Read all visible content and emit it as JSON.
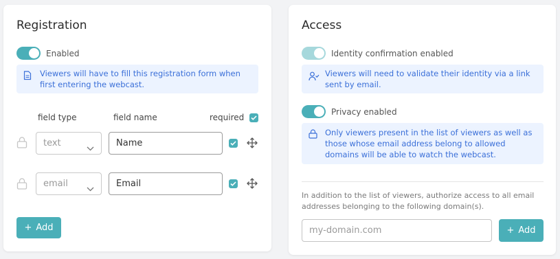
{
  "registration": {
    "title": "Registration",
    "enabled_label": "Enabled",
    "info_text": "Viewers will have to fill this registration form when first entering the webcast.",
    "headers": {
      "field_type": "field type",
      "field_name": "field name",
      "required": "required"
    },
    "fields": [
      {
        "type": "text",
        "name": "Name",
        "required": true
      },
      {
        "type": "email",
        "name": "Email",
        "required": true
      }
    ],
    "add_label": "Add"
  },
  "access": {
    "title": "Access",
    "identity_label": "Identity confirmation enabled",
    "identity_info": "Viewers will need to validate their identity via a link sent by email.",
    "privacy_label": "Privacy enabled",
    "privacy_info": "Only viewers present in the list of viewers as well as those whose email address belong to allowed domains will be able to watch the webcast.",
    "domain_note": "In addition to the list of viewers, authorize access to all email addresses belonging to the following domain(s).",
    "domain_placeholder": "my-domain.com",
    "add_label": "Add"
  },
  "colors": {
    "accent": "#4aafb8",
    "accent_light": "#a6d8dc",
    "info_bg": "#ecf3ff",
    "info_text": "#3a6fd8"
  }
}
